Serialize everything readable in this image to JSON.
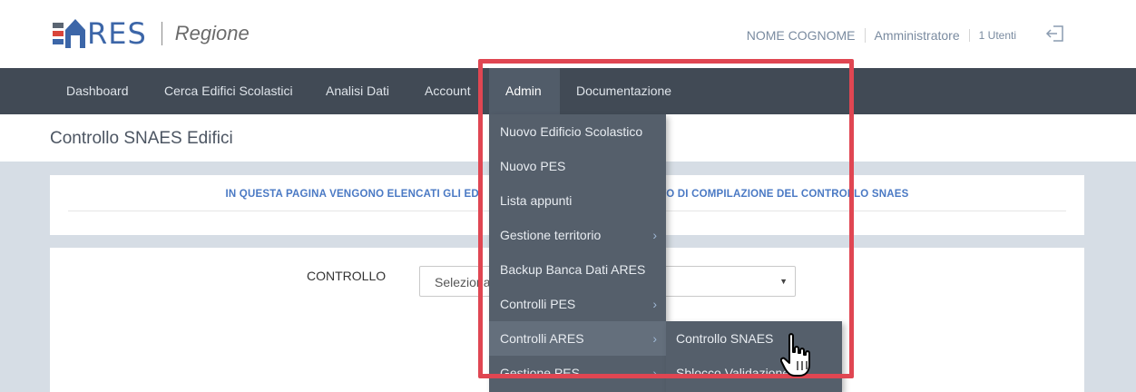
{
  "header": {
    "logo_text": "RES",
    "region": "Regione",
    "user_name": "NOME COGNOME",
    "role": "Amministratore",
    "users_count": "1 Utenti",
    "logout_icon": "logout-icon",
    "logo_colors": {
      "bar1": "#5b6572",
      "bar2": "#d9453a",
      "bar3": "#3c66a8",
      "house": "#3c66a8"
    }
  },
  "nav": {
    "items": [
      {
        "label": "Dashboard"
      },
      {
        "label": "Cerca Edifici Scolastici"
      },
      {
        "label": "Analisi Dati"
      },
      {
        "label": "Account"
      },
      {
        "label": "Admin",
        "active": true
      },
      {
        "label": "Documentazione"
      }
    ]
  },
  "page": {
    "title": "Controllo SNAES Edifici",
    "info": "IN QUESTA PAGINA VENGONO ELENCATI GLI EDI",
    "info_tail": "TO DI COMPILAZIONE DEL CONTROLLO SNAES",
    "control_label": "CONTROLLO",
    "select_value": "Seleziona"
  },
  "admin_menu": {
    "items": [
      {
        "label": "Nuovo Edificio Scolastico",
        "has_submenu": false
      },
      {
        "label": "Nuovo PES",
        "has_submenu": false
      },
      {
        "label": "Lista appunti",
        "has_submenu": false
      },
      {
        "label": "Gestione territorio",
        "has_submenu": true
      },
      {
        "label": "Backup Banca Dati ARES",
        "has_submenu": false
      },
      {
        "label": "Controlli PES",
        "has_submenu": true
      },
      {
        "label": "Controlli ARES",
        "has_submenu": true,
        "highlighted": true
      },
      {
        "label": "Gestione PES",
        "has_submenu": true
      }
    ],
    "chevron": "›"
  },
  "submenu": {
    "items": [
      {
        "label": "Controllo SNAES"
      },
      {
        "label": "Sblocco Validazione"
      }
    ]
  },
  "colors": {
    "nav_bg": "#414a55",
    "menu_bg": "#555f6b",
    "accent_blue": "#4a79c4",
    "highlight_red": "#e04652"
  }
}
